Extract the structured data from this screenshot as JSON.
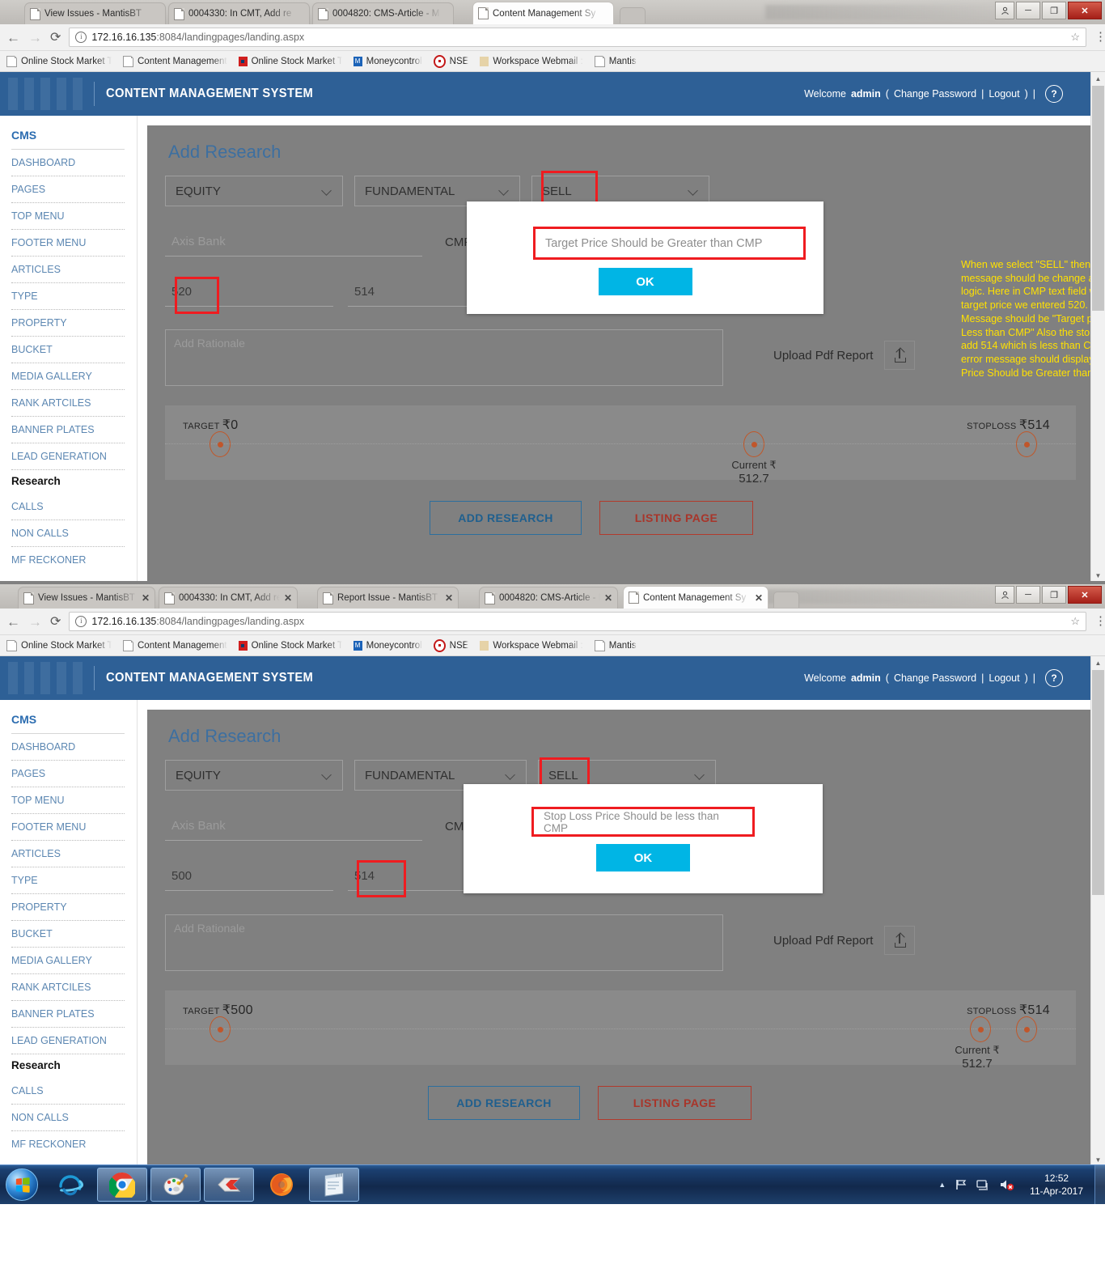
{
  "browser": {
    "window1": {
      "tabs": [
        {
          "title": "View Issues - MantisBT",
          "active": false
        },
        {
          "title": "0004330: In CMT, Add re",
          "active": false
        },
        {
          "title": "0004820: CMS-Article - M",
          "active": false
        },
        {
          "title": "Content Management Sy",
          "active": true
        }
      ],
      "url_host": "172.16.16.135",
      "url_rest": ":8084/landingpages/landing.aspx"
    },
    "window2": {
      "tabs": [
        {
          "title": "View Issues - MantisBT",
          "active": false
        },
        {
          "title": "0004330: In CMT, Add re",
          "active": false
        },
        {
          "title": "Report Issue - MantisBT",
          "active": false
        },
        {
          "title": "0004820: CMS-Article - M",
          "active": false
        },
        {
          "title": "Content Management Sy",
          "active": true
        }
      ],
      "url_host": "172.16.16.135",
      "url_rest": ":8084/landingpages/landing.aspx"
    },
    "close_label": "✕",
    "minimize_label": "─",
    "maximize_label": "❐",
    "user_label": "○",
    "back_label": "←",
    "forward_label": "→",
    "reload_label": "⟳",
    "info_label": "i",
    "star_label": "☆",
    "menu_label": "⋮",
    "bookmarks": [
      {
        "label": "Online Stock Market T",
        "icon": "doc-icon"
      },
      {
        "label": "Content Management",
        "icon": "doc-icon"
      },
      {
        "label": "Online Stock Market T",
        "icon": "red-square-icon"
      },
      {
        "label": "Moneycontrol",
        "icon": "moneycontrol-icon"
      },
      {
        "label": "NSE",
        "icon": "nse-icon"
      },
      {
        "label": "Workspace Webmail :",
        "icon": "webmail-icon"
      },
      {
        "label": "Mantis",
        "icon": "doc-icon"
      }
    ]
  },
  "app": {
    "title": "CONTENT MANAGEMENT SYSTEM",
    "welcome_prefix": "Welcome",
    "user": "admin",
    "paren_open": "(",
    "change_password": "Change Password",
    "pipe": "|",
    "logout": "Logout",
    "paren_close": ")",
    "help": "?"
  },
  "sidebar": {
    "heading": "CMS",
    "items": [
      {
        "label": "DASHBOARD"
      },
      {
        "label": "PAGES"
      },
      {
        "label": "TOP MENU"
      },
      {
        "label": "FOOTER MENU"
      },
      {
        "label": "ARTICLES"
      },
      {
        "label": "TYPE"
      },
      {
        "label": "PROPERTY"
      },
      {
        "label": "BUCKET"
      },
      {
        "label": "MEDIA GALLERY"
      },
      {
        "label": "RANK ARTCILES"
      },
      {
        "label": "BANNER PLATES"
      },
      {
        "label": "LEAD GENERATION"
      }
    ],
    "section2_heading": "Research",
    "items2": [
      {
        "label": "CALLS"
      },
      {
        "label": "NON CALLS"
      },
      {
        "label": "MF RECKONER"
      }
    ]
  },
  "form": {
    "title": "Add Research",
    "select_category": "EQUITY",
    "select_type": "FUNDAMENTAL",
    "select_action": "SELL",
    "select_fourth": "",
    "company_placeholder": "Axis Bank",
    "cmp_label": "CMP",
    "rationale_placeholder": "Add Rationale",
    "upload_label": "Upload Pdf Report",
    "upload_icon": "upload-icon",
    "add_research_button": "ADD RESEARCH",
    "listing_page_button": "LISTING PAGE"
  },
  "panel1": {
    "target_value": "520",
    "stoploss_value": "514",
    "dialog_message": "Target Price Should be Greater than CMP",
    "dialog_ok": "OK",
    "slider": {
      "target_label": "TARGET",
      "target_amount": "₹0",
      "stoploss_label": "STOPLOSS",
      "stoploss_amount": "₹514",
      "current_label": "Current ₹",
      "current_value": "512.7"
    },
    "annotation": "When we select \"SELL\" then the  popup message should be change  according to the logic. Here in CMP text field we entered 515 & target price we entered 520. Then for SELL the Message should be \"Target price should be Less than CMP\" Also the stop loss when we add  514 which is less than CMP i.e 515 the error message should display as \"Stop Loss Price Should be Greater than CMP\""
  },
  "panel2": {
    "target_value": "500",
    "stoploss_value": "514",
    "dialog_message": "Stop Loss Price Should be less than CMP",
    "dialog_ok": "OK",
    "slider": {
      "target_label": "TARGET",
      "target_amount": "₹500",
      "stoploss_label": "STOPLOSS",
      "stoploss_amount": "₹514",
      "current_label": "Current ₹",
      "current_value": "512.7"
    }
  },
  "taskbar": {
    "start_icon": "windows-start-icon",
    "items": [
      {
        "icon": "internet-explorer-icon",
        "active": false
      },
      {
        "icon": "google-chrome-icon",
        "active": true
      },
      {
        "icon": "paint-icon",
        "active": true
      },
      {
        "icon": "snagit-icon",
        "active": true
      },
      {
        "icon": "firefox-icon",
        "active": false
      },
      {
        "icon": "notepad-icon",
        "active": true
      }
    ],
    "tray": [
      {
        "icon": "show-hidden-icons-arrow"
      },
      {
        "icon": "action-center-flag-icon"
      },
      {
        "icon": "network-icon"
      },
      {
        "icon": "volume-muted-icon"
      }
    ],
    "time": "12:52",
    "date": "11-Apr-2017"
  },
  "colors": {
    "header_blue": "#2e6096",
    "accent_link": "#5c87b2",
    "alert_red": "#ef1c20",
    "ok_cyan": "#00b5e5",
    "annotation_yellow": "#ffe100",
    "card_gray": "#808080"
  }
}
